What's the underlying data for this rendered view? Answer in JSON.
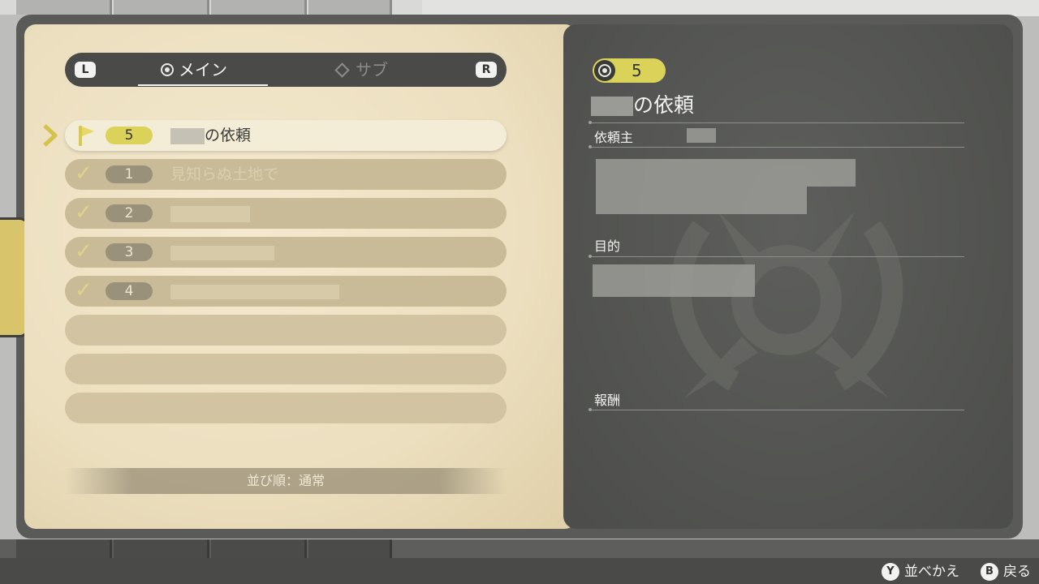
{
  "header": {
    "left_key": "L",
    "right_key": "R",
    "tabs": [
      {
        "label": "メイン",
        "icon": "ring-icon",
        "selected": true
      },
      {
        "label": "サブ",
        "icon": "diamond-icon",
        "selected": false
      }
    ]
  },
  "requests": [
    {
      "number": "5",
      "title_suffix": "の依頼",
      "status": "active",
      "icon": "flag-icon"
    },
    {
      "number": "1",
      "title": "見知らぬ土地で",
      "status": "completed",
      "icon": "check-icon"
    },
    {
      "number": "2",
      "title": "",
      "status": "completed",
      "icon": "check-icon"
    },
    {
      "number": "3",
      "title": "",
      "status": "completed",
      "icon": "check-icon"
    },
    {
      "number": "4",
      "title": "",
      "status": "completed",
      "icon": "check-icon"
    }
  ],
  "sort": {
    "label": "並び順：通常"
  },
  "detail": {
    "number": "5",
    "title_suffix": "の依頼",
    "client_label": "依頼主",
    "objective_label": "目的",
    "reward_label": "報酬"
  },
  "footer": {
    "hints": [
      {
        "button": "Y",
        "label": "並べかえ"
      },
      {
        "button": "B",
        "label": "戻る"
      }
    ]
  },
  "colors": {
    "accent_yellow": "#dbd25a",
    "parchment": "#ecdfbf",
    "dark_panel": "#565754"
  }
}
